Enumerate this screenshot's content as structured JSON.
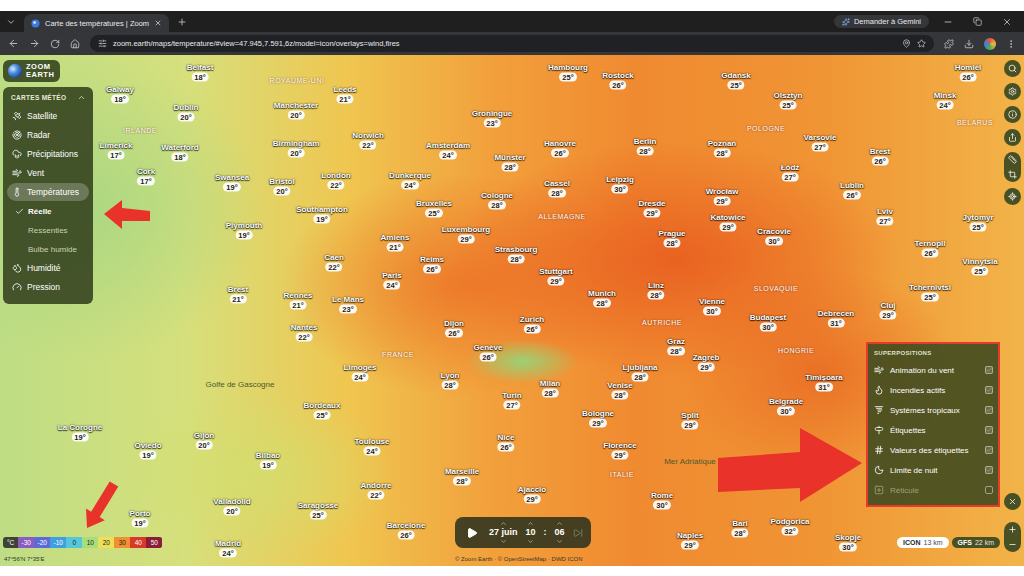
{
  "browser": {
    "tabs": [
      {
        "title": "Carte des températures | Zoom",
        "selected": true
      }
    ],
    "gemini": "Demander à Gemini",
    "url": "zoom.earth/maps/temperature/#view=47.945,7.591,6z/model=icon/overlays=wind,fires"
  },
  "logo": {
    "line1": "ZOOM",
    "line2": "EARTH"
  },
  "weather_menu": {
    "title": "CARTES MÉTÉO",
    "expanded": true,
    "items": [
      {
        "label": "Satellite",
        "selected": false,
        "expanded": false,
        "subitems": []
      },
      {
        "label": "Radar",
        "selected": false,
        "expanded": false,
        "subitems": []
      },
      {
        "label": "Précipitations",
        "selected": false,
        "expanded": false,
        "subitems": []
      },
      {
        "label": "Vent",
        "selected": false,
        "expanded": false,
        "subitems": []
      },
      {
        "label": "Températures",
        "selected": true,
        "expanded": true,
        "subitems": [
          {
            "label": "Réelle",
            "selected": true
          },
          {
            "label": "Ressenties",
            "selected": false
          },
          {
            "label": "Bulbe humide",
            "selected": false
          }
        ]
      },
      {
        "label": "Humidité",
        "selected": false,
        "expanded": false,
        "subitems": []
      },
      {
        "label": "Pression",
        "selected": false,
        "expanded": false,
        "subitems": []
      }
    ]
  },
  "overlays": {
    "title": "SUPERPOSITIONS",
    "items": [
      {
        "label": "Animation du vent",
        "on": true
      },
      {
        "label": "Incendies actifs",
        "on": true
      },
      {
        "label": "Systèmes tropicaux",
        "on": true
      },
      {
        "label": "Étiquettes",
        "on": true
      },
      {
        "label": "Valeurs des étiquettes",
        "on": true
      },
      {
        "label": "Limite de nuit",
        "on": true
      },
      {
        "label": "Réticule",
        "on": false
      }
    ]
  },
  "map": {
    "countries": [
      "ROYAUME-UNI",
      "IRLANDE",
      "FRANCE",
      "ALLEMAGNE",
      "POLOGNE",
      "BÉLARUS",
      "AUTRICHE",
      "SLOVAQUIE",
      "HONGRIE",
      "ITALIE"
    ],
    "seas": [
      "Golfe de Gascogne",
      "Mer Adriatique"
    ],
    "cities": [
      {
        "name": "Belfast",
        "temp": "18°"
      },
      {
        "name": "Galway",
        "temp": "18°"
      },
      {
        "name": "Dublin",
        "temp": "20°"
      },
      {
        "name": "Limerick",
        "temp": "17°"
      },
      {
        "name": "Waterford",
        "temp": "18°"
      },
      {
        "name": "Cork",
        "temp": "17°"
      },
      {
        "name": "Manchester",
        "temp": "20°"
      },
      {
        "name": "Leeds",
        "temp": "21°"
      },
      {
        "name": "Birmingham",
        "temp": "20°"
      },
      {
        "name": "Norwich",
        "temp": "22°"
      },
      {
        "name": "Swansea",
        "temp": "19°"
      },
      {
        "name": "Bristol",
        "temp": "20°"
      },
      {
        "name": "London",
        "temp": "22°"
      },
      {
        "name": "Southampton",
        "temp": "19°"
      },
      {
        "name": "Plymouth",
        "temp": "19°"
      },
      {
        "name": "Amsterdam",
        "temp": "24°"
      },
      {
        "name": "Groningue",
        "temp": "23°"
      },
      {
        "name": "Dunkerque",
        "temp": "24°"
      },
      {
        "name": "Bruxelles",
        "temp": "25°"
      },
      {
        "name": "Hambourg",
        "temp": "25°"
      },
      {
        "name": "Rostock",
        "temp": "26°"
      },
      {
        "name": "Hanovre",
        "temp": "26°"
      },
      {
        "name": "Münster",
        "temp": "28°"
      },
      {
        "name": "Berlin",
        "temp": "28°"
      },
      {
        "name": "Cologne",
        "temp": "28°"
      },
      {
        "name": "Cassel",
        "temp": "28°"
      },
      {
        "name": "Leipzig",
        "temp": "30°"
      },
      {
        "name": "Dresde",
        "temp": "29°"
      },
      {
        "name": "Luxembourg",
        "temp": "29°"
      },
      {
        "name": "Strasbourg",
        "temp": "28°"
      },
      {
        "name": "Stuttgart",
        "temp": "29°"
      },
      {
        "name": "Munich",
        "temp": "28°"
      },
      {
        "name": "Prague",
        "temp": "28°"
      },
      {
        "name": "Gdańsk",
        "temp": "25°"
      },
      {
        "name": "Olsztyn",
        "temp": "25°"
      },
      {
        "name": "Poznań",
        "temp": "28°"
      },
      {
        "name": "Varsovie",
        "temp": "27°"
      },
      {
        "name": "Łódź",
        "temp": "27°"
      },
      {
        "name": "Wrocław",
        "temp": "29°"
      },
      {
        "name": "Katowice",
        "temp": "29°"
      },
      {
        "name": "Cracovie",
        "temp": "30°"
      },
      {
        "name": "Lublin",
        "temp": "26°"
      },
      {
        "name": "Homiel",
        "temp": "26°"
      },
      {
        "name": "Minsk",
        "temp": "24°"
      },
      {
        "name": "Brest",
        "temp": "26°"
      },
      {
        "name": "Lviv",
        "temp": "27°"
      },
      {
        "name": "Jytomyr",
        "temp": "25°"
      },
      {
        "name": "Ternopil",
        "temp": "26°"
      },
      {
        "name": "Vinnytsia",
        "temp": "25°"
      },
      {
        "name": "Tchernivtsi",
        "temp": "25°"
      },
      {
        "name": "Linz",
        "temp": "28°"
      },
      {
        "name": "Vienne",
        "temp": "30°"
      },
      {
        "name": "Budapest",
        "temp": "30°"
      },
      {
        "name": "Debrecen",
        "temp": "31°"
      },
      {
        "name": "Cluj",
        "temp": "29°"
      },
      {
        "name": "Graz",
        "temp": "28°"
      },
      {
        "name": "Ljubljana",
        "temp": "28°"
      },
      {
        "name": "Zagreb",
        "temp": "29°"
      },
      {
        "name": "Timișoara",
        "temp": "31°"
      },
      {
        "name": "Belgrade",
        "temp": "30°"
      },
      {
        "name": "Split",
        "temp": "29°"
      },
      {
        "name": "Amiens",
        "temp": "21°"
      },
      {
        "name": "Caen",
        "temp": "22°"
      },
      {
        "name": "Reims",
        "temp": "26°"
      },
      {
        "name": "Paris",
        "temp": "24°"
      },
      {
        "name": "Brest",
        "temp": "21°"
      },
      {
        "name": "Rennes",
        "temp": "21°"
      },
      {
        "name": "Le Mans",
        "temp": "23°"
      },
      {
        "name": "Nantes",
        "temp": "22°"
      },
      {
        "name": "Dijon",
        "temp": "26°"
      },
      {
        "name": "Zurich",
        "temp": "26°"
      },
      {
        "name": "Genève",
        "temp": "26°"
      },
      {
        "name": "Limoges",
        "temp": "24°"
      },
      {
        "name": "Lyon",
        "temp": "28°"
      },
      {
        "name": "Bordeaux",
        "temp": "25°"
      },
      {
        "name": "Toulouse",
        "temp": "24°"
      },
      {
        "name": "Nice",
        "temp": "26°"
      },
      {
        "name": "Turin",
        "temp": "27°"
      },
      {
        "name": "Milan",
        "temp": "28°"
      },
      {
        "name": "Venise",
        "temp": "28°"
      },
      {
        "name": "Bologne",
        "temp": "29°"
      },
      {
        "name": "Florence",
        "temp": "29°"
      },
      {
        "name": "Marseille",
        "temp": "28°"
      },
      {
        "name": "Ajaccio",
        "temp": "29°"
      },
      {
        "name": "Rome",
        "temp": "30°"
      },
      {
        "name": "La Corogne",
        "temp": "19°"
      },
      {
        "name": "Oviedo",
        "temp": "19°"
      },
      {
        "name": "Gijón",
        "temp": "20°"
      },
      {
        "name": "Bilbao",
        "temp": "19°"
      },
      {
        "name": "Andorre",
        "temp": "22°"
      },
      {
        "name": "Porto",
        "temp": "19°"
      },
      {
        "name": "Valladolid",
        "temp": "20°"
      },
      {
        "name": "Saragosse",
        "temp": "25°"
      },
      {
        "name": "Barcelone",
        "temp": "26°"
      },
      {
        "name": "Madrid",
        "temp": "24°"
      },
      {
        "name": "Naples",
        "temp": "29°"
      },
      {
        "name": "Bari",
        "temp": "28°"
      },
      {
        "name": "Podgorica",
        "temp": "32°"
      },
      {
        "name": "Skopje",
        "temp": "30°"
      }
    ]
  },
  "legend": {
    "unit": "°C",
    "ticks": [
      {
        "label": "-30",
        "color": "#8a5ec0"
      },
      {
        "label": "-20",
        "color": "#5c6cd6"
      },
      {
        "label": "-10",
        "color": "#3f9fe0"
      },
      {
        "label": "0",
        "color": "#56c7d8"
      },
      {
        "label": "10",
        "color": "#a8de7a"
      },
      {
        "label": "20",
        "color": "#ece05a"
      },
      {
        "label": "30",
        "color": "#f09030"
      },
      {
        "label": "40",
        "color": "#d83a2a"
      },
      {
        "label": "50",
        "color": "#8a1e3a"
      }
    ]
  },
  "coordinates": "47°56'N 7°35'E",
  "time": {
    "date": "27 juin",
    "hour": "10",
    "separator": ":",
    "minute": "06"
  },
  "models": [
    {
      "name": "ICON",
      "resolution": "13 km",
      "selected": true
    },
    {
      "name": "GFS",
      "resolution": "22 km",
      "selected": false
    }
  ],
  "attribution": "© Zoom Earth · © OpenStreetMap · DWD ICON"
}
